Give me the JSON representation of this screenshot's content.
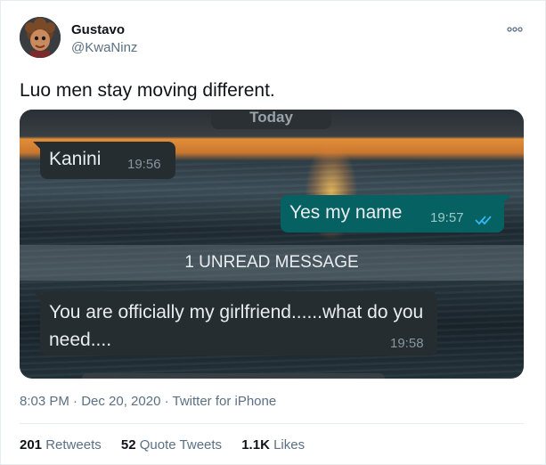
{
  "tweet": {
    "author": {
      "name": "Gustavo",
      "handle": "@KwaNinz"
    },
    "text": "Luo men stay moving different.",
    "timestamp": "8:03 PM · Dec 20, 2020",
    "source": "Twitter for iPhone",
    "metaline": "8:03 PM · Dec 20, 2020 · Twitter for iPhone",
    "stats": {
      "retweets": {
        "count": "201",
        "label": "Retweets"
      },
      "quote_tweets": {
        "count": "52",
        "label": "Quote Tweets"
      },
      "likes": {
        "count": "1.1K",
        "label": "Likes"
      }
    }
  },
  "screenshot": {
    "date_chip": "Today",
    "messages": [
      {
        "text": "Kanini",
        "time": "19:56",
        "direction": "incoming"
      },
      {
        "text": "Yes my name",
        "time": "19:57",
        "direction": "outgoing",
        "status": "read-double-tick"
      },
      {
        "text": "You are officially my girlfriend......what do you need....",
        "time": "19:58",
        "direction": "incoming"
      }
    ],
    "unread_banner": "1 UNREAD MESSAGE"
  },
  "colors": {
    "link_gray": "#5b7083",
    "outgoing_bubble": "#056162",
    "incoming_bubble": "#262d31",
    "tick_blue": "#34b7f1"
  },
  "icons": [
    "more-options-icon",
    "double-check-icon"
  ]
}
